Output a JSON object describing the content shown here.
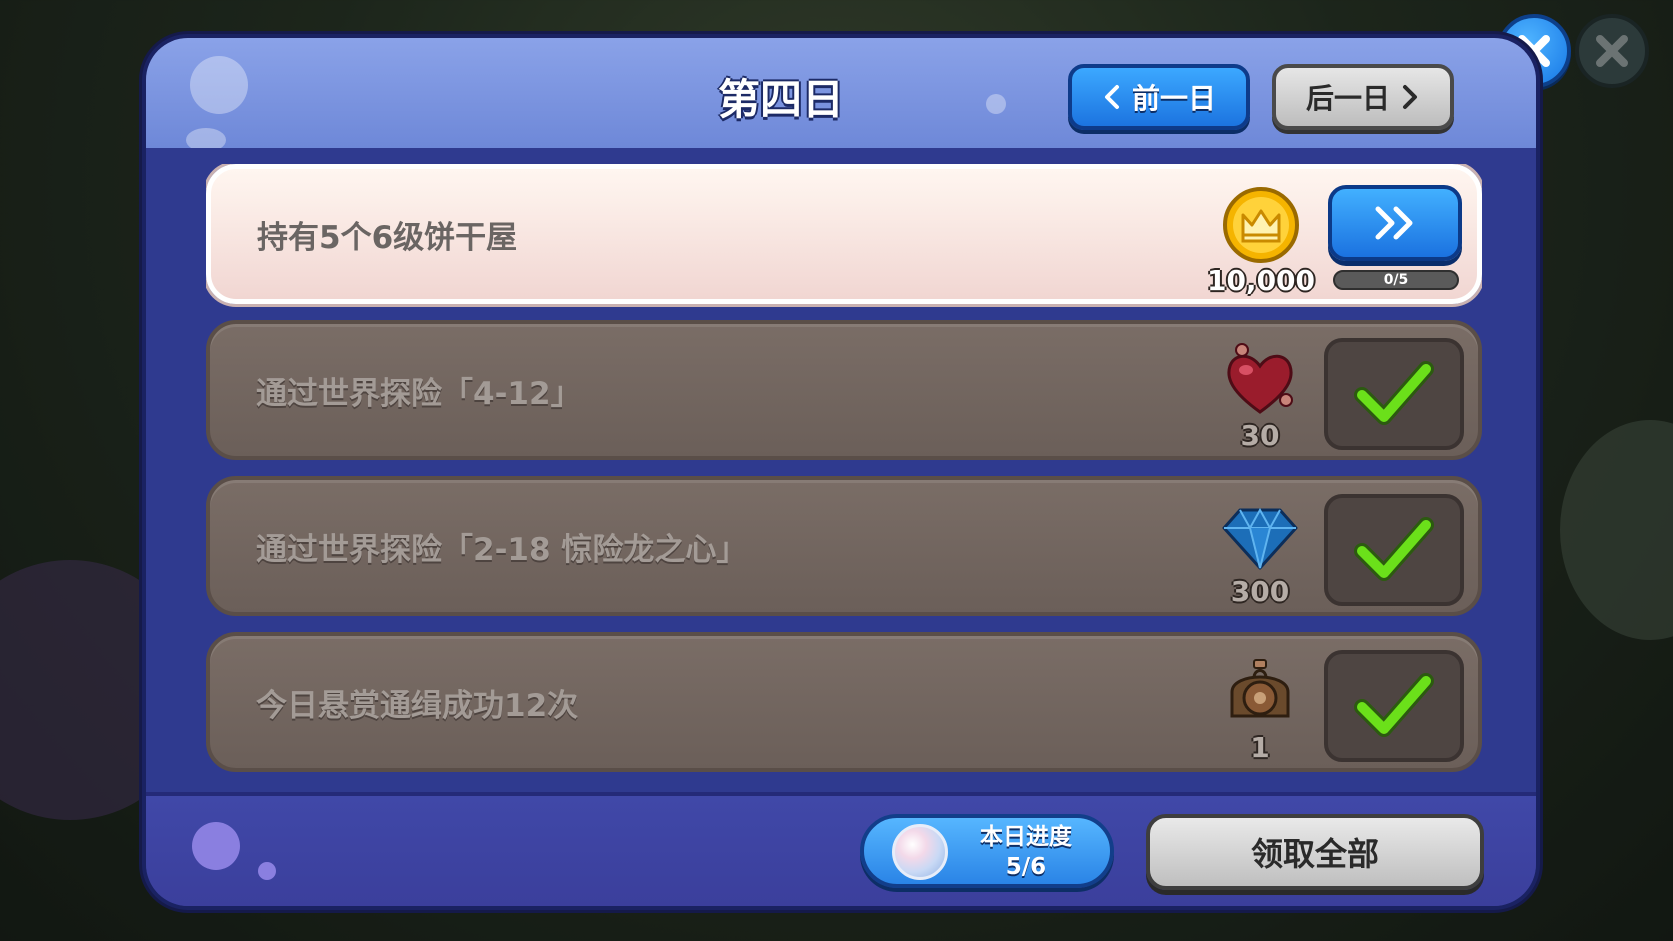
{
  "dialog": {
    "title": "第四日",
    "prev_label": "前一日",
    "next_label": "后一日"
  },
  "tasks": [
    {
      "label": "持有5个6级饼干屋",
      "reward_icon": "crown-coin-icon",
      "reward_amount": "10,000",
      "status": "in-progress",
      "progress_text": "0/5",
      "progress_fraction": 0
    },
    {
      "label": "通过世界探险「4-12」",
      "reward_icon": "heart-jelly-icon",
      "reward_amount": "30",
      "status": "completed"
    },
    {
      "label": "通过世界探险「2-18 惊险龙之心」",
      "reward_icon": "blue-crystal-icon",
      "reward_amount": "300",
      "status": "completed"
    },
    {
      "label": "今日悬赏通缉成功12次",
      "reward_icon": "treasure-pouch-icon",
      "reward_amount": "1",
      "status": "completed"
    }
  ],
  "footer": {
    "daily_progress_label": "本日进度",
    "daily_progress_value": "5/6",
    "claim_all_label": "领取全部"
  },
  "colors": {
    "dialog_bg": "#2f3a8f",
    "header_bg": "#7c94e0",
    "primary_button": "#1c74e0",
    "disabled_button": "#bfbfbf",
    "check_green": "#6be01a",
    "completed_row": "#6b5f59",
    "active_row": "#f4e2de"
  }
}
